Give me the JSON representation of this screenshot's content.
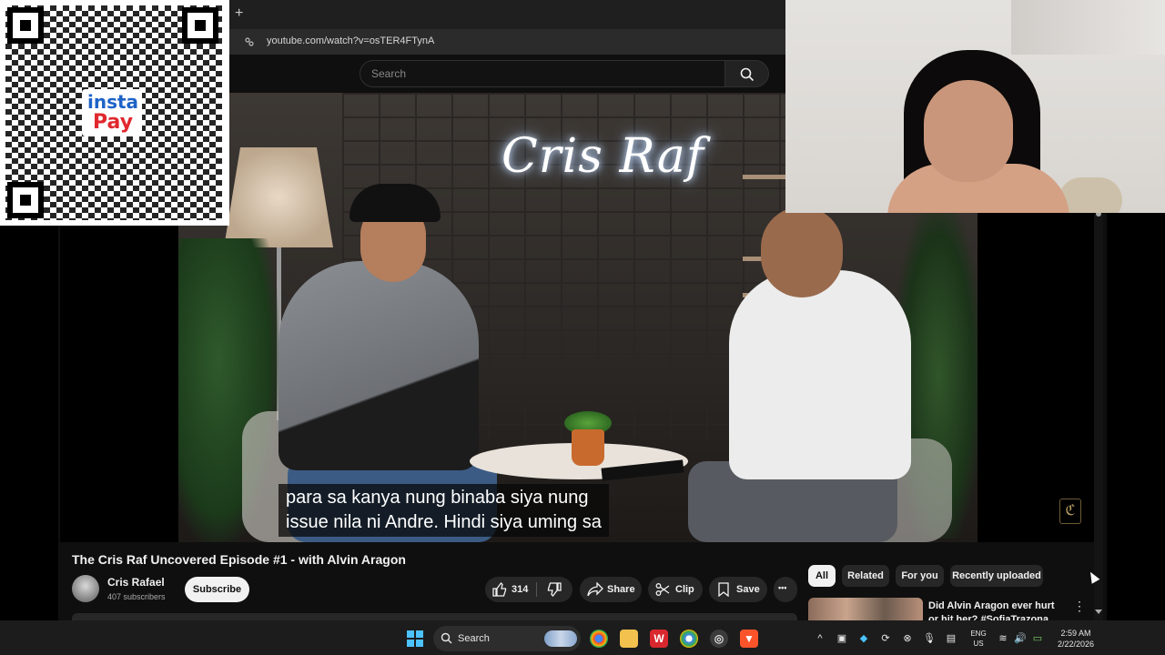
{
  "browser": {
    "new_tab_symbol": "+",
    "url": "youtube.com/watch?v=osTER4FTynA"
  },
  "header": {
    "search_placeholder": "Search"
  },
  "video": {
    "neon_sign": "Cris Raf",
    "captions": [
      "para sa kanya nung binaba siya nung",
      "issue nila ni Andre. Hindi siya uming sa"
    ],
    "title": "The Cris Raf Uncovered Episode #1 - with Alvin Aragon"
  },
  "channel": {
    "name": "Cris Rafael",
    "subscribers": "407 subscribers",
    "subscribe_label": "Subscribe"
  },
  "actions": {
    "like_count": "314",
    "share_label": "Share",
    "clip_label": "Clip",
    "save_label": "Save",
    "more_label": "•••"
  },
  "chips": [
    "All",
    "Related",
    "For you",
    "Recently uploaded"
  ],
  "recommendation": {
    "title": "Did Alvin Aragon ever hurt or hit her? #SofiaTrazona #Izzy"
  },
  "qr_overlay": {
    "logo_top": "insta",
    "logo_bottom": "Pay"
  },
  "taskbar": {
    "search_label": "Search",
    "lang_top": "ENG",
    "lang_bottom": "US",
    "time": "2:59 AM",
    "date": "2/22/2026"
  },
  "colors": {
    "youtube_bg": "#0f0f0f",
    "pill_bg": "#272727",
    "accent_blue": "#4cc2ff",
    "instapay_blue": "#1e63c7",
    "instapay_red": "#e0282e"
  }
}
